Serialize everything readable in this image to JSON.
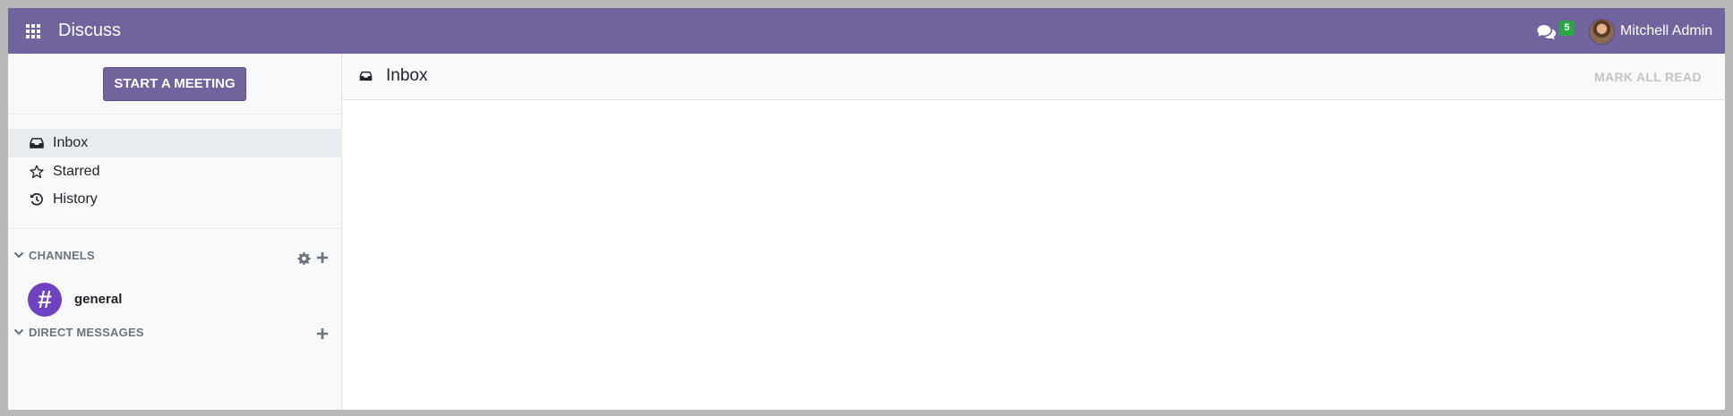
{
  "navbar": {
    "app_title": "Discuss",
    "apps_icon": "apps-grid-icon",
    "chat_icon": "comments-icon",
    "chat_count": "5",
    "user_name": "Mitchell Admin"
  },
  "sidebar": {
    "start_meeting_label": "START A MEETING",
    "mailboxes": [
      {
        "label": "Inbox",
        "icon": "inbox-icon",
        "active": true
      },
      {
        "label": "Starred",
        "icon": "star-icon",
        "active": false
      },
      {
        "label": "History",
        "icon": "history-icon",
        "active": false
      }
    ],
    "channels_header": "CHANNELS",
    "channels": [
      {
        "name": "general",
        "avatar_glyph": "#"
      }
    ],
    "direct_messages_header": "DIRECT MESSAGES"
  },
  "main": {
    "title": "Inbox",
    "mark_all_read_label": "MARK ALL READ"
  },
  "colors": {
    "brand": "#71639e",
    "badge": "#28a745",
    "channel_avatar": "#6f42c1"
  }
}
